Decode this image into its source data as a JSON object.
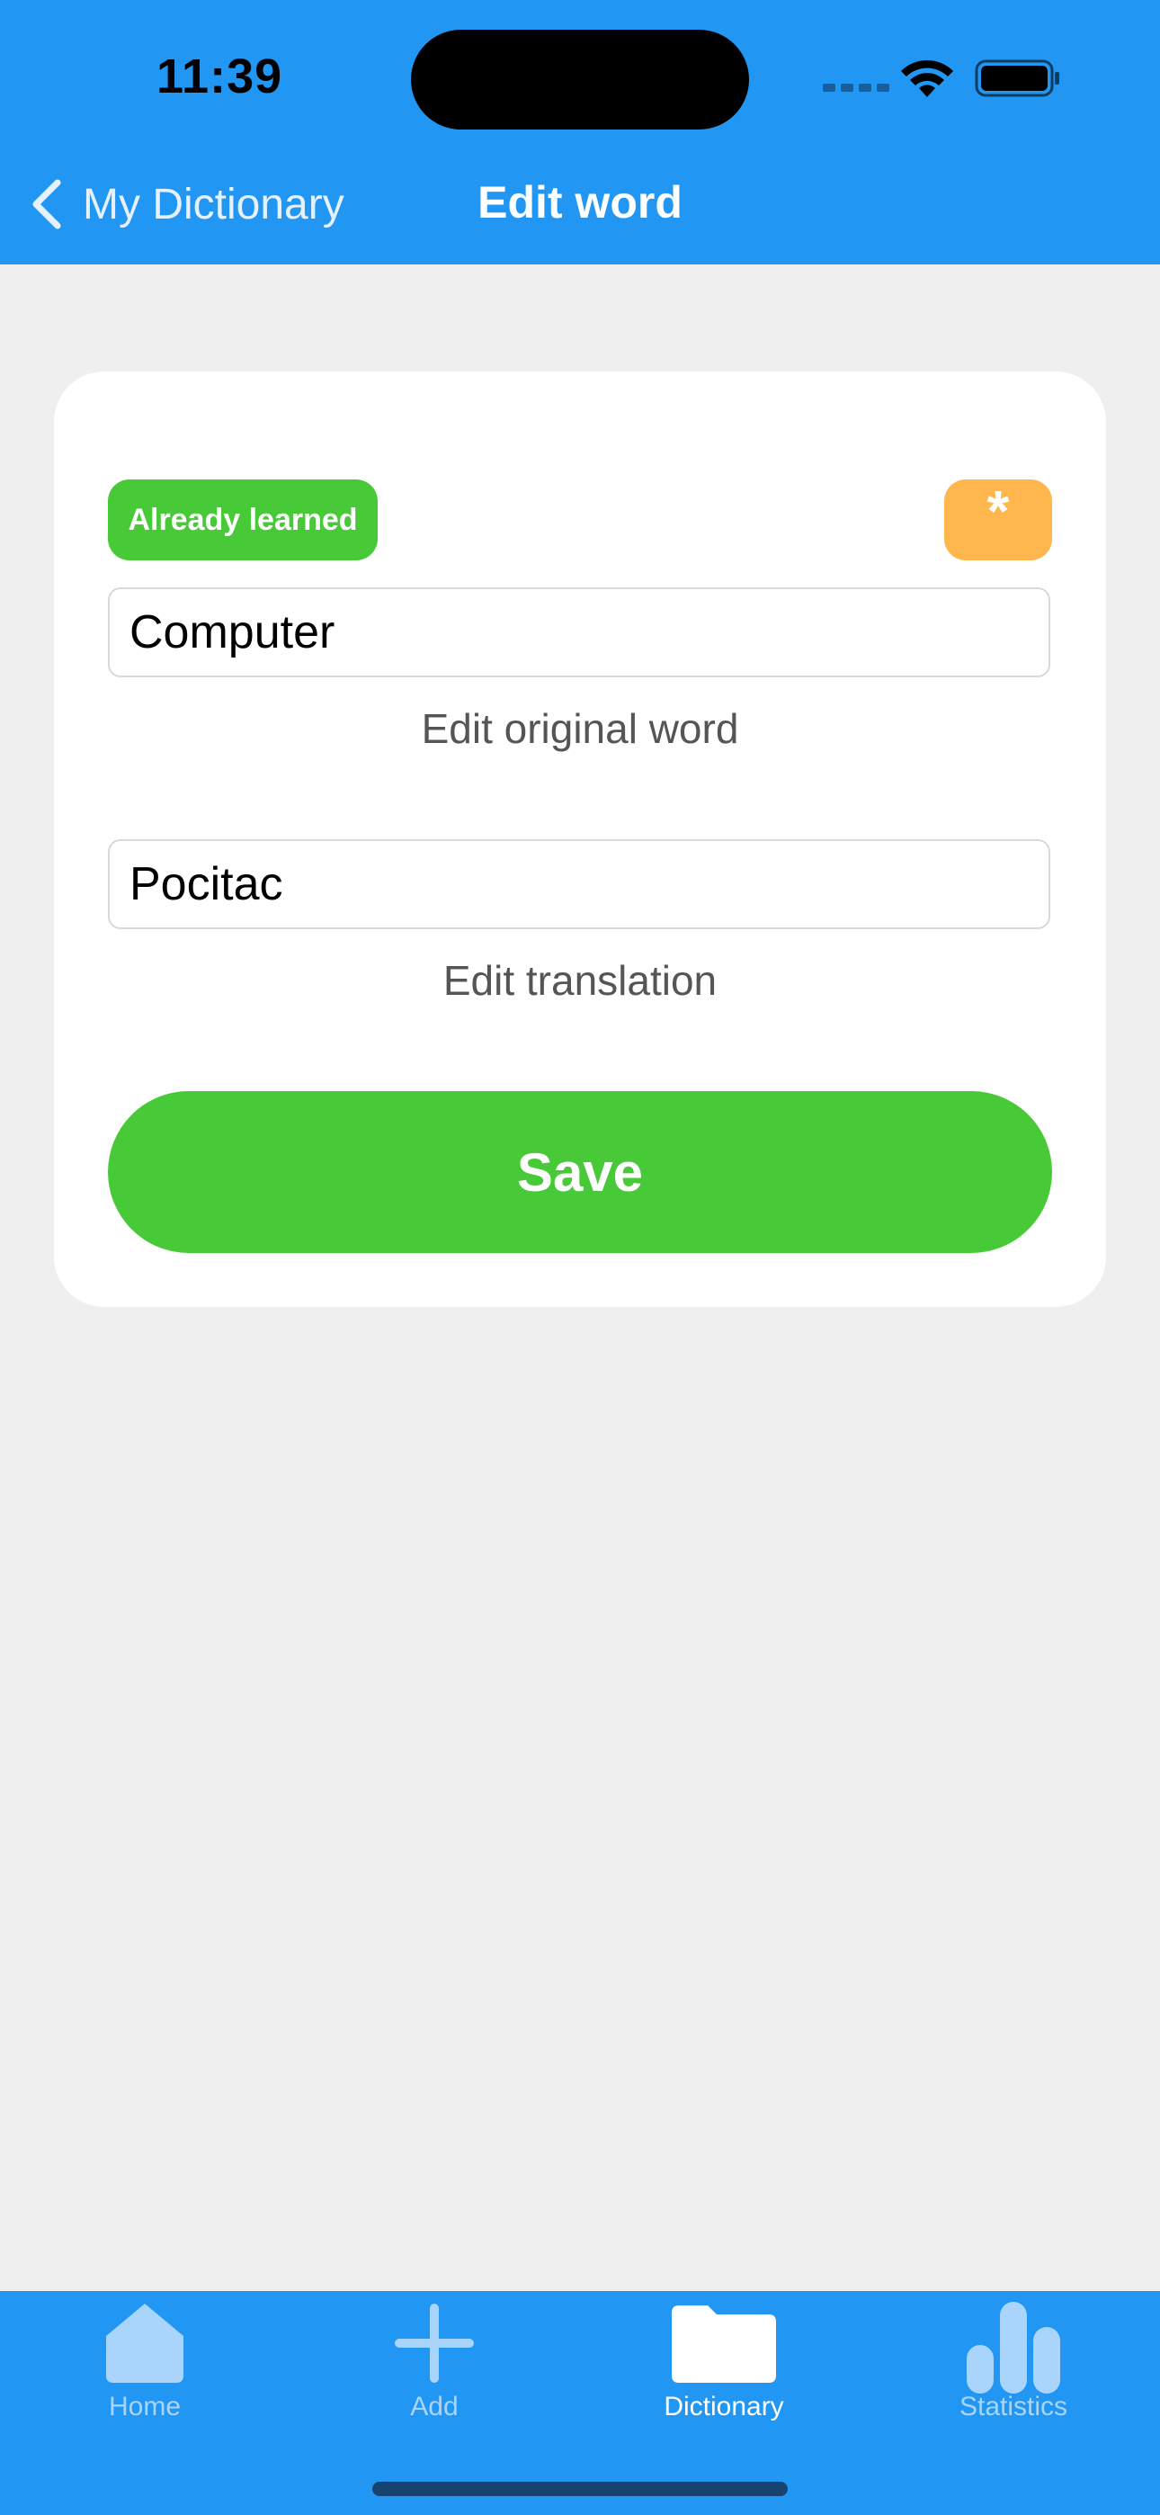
{
  "status_bar": {
    "time": "11:39"
  },
  "nav": {
    "back_label": "My Dictionary",
    "title": "Edit word"
  },
  "card": {
    "learned_badge": "Already learned",
    "star_button": "*",
    "original_word": "Computer",
    "original_caption": "Edit original word",
    "translation": "Pocitac",
    "translation_caption": "Edit translation",
    "save_label": "Save"
  },
  "tabbar": {
    "items": [
      {
        "label": "Home",
        "icon": "home-icon",
        "active": false
      },
      {
        "label": "Add",
        "icon": "plus-icon",
        "active": false
      },
      {
        "label": "Dictionary",
        "icon": "folder-icon",
        "active": true
      },
      {
        "label": "Statistics",
        "icon": "bar-chart-icon",
        "active": false
      }
    ]
  },
  "colors": {
    "primary_blue": "#2196f3",
    "green": "#48c937",
    "orange": "#ffb74d",
    "background": "#efefef"
  }
}
